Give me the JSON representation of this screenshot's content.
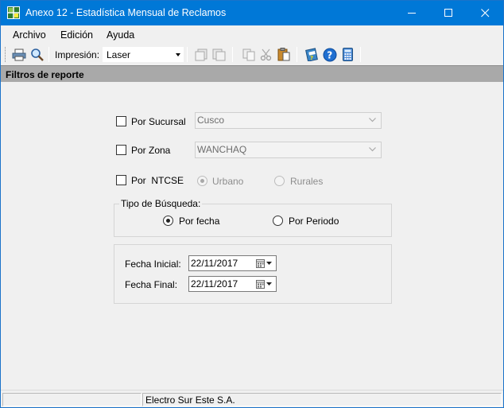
{
  "window": {
    "title": "Anexo 12 - Estadística Mensual de Reclamos"
  },
  "menu": [
    "Archivo",
    "Edición",
    "Ayuda"
  ],
  "toolbar": {
    "print_label": "Impresión:",
    "printer_value": "Laser"
  },
  "section": {
    "title": "Filtros de reporte"
  },
  "filters": {
    "sucursal": {
      "label": "Por Sucursal",
      "checked": false,
      "value": "Cusco"
    },
    "zona": {
      "label": "Por Zona",
      "checked": false,
      "value": "WANCHAQ"
    },
    "ntcse": {
      "label": "Por  NTCSE",
      "checked": false,
      "option_urbano": "Urbano",
      "option_rurales": "Rurales"
    }
  },
  "busqueda": {
    "legend": "Tipo de Búsqueda:",
    "por_fecha": "Por fecha",
    "por_periodo": "Por Periodo",
    "selected": "por_fecha"
  },
  "fechas": {
    "inicial_label": "Fecha Inicial:",
    "inicial_value": "22/11/2017",
    "final_label": "Fecha Final:",
    "final_value": "22/11/2017"
  },
  "status": {
    "company": "Electro Sur Este S.A."
  },
  "colors": {
    "titlebar": "#0078d7",
    "section_header": "#a9a9a9",
    "background": "#f0f0f0"
  }
}
